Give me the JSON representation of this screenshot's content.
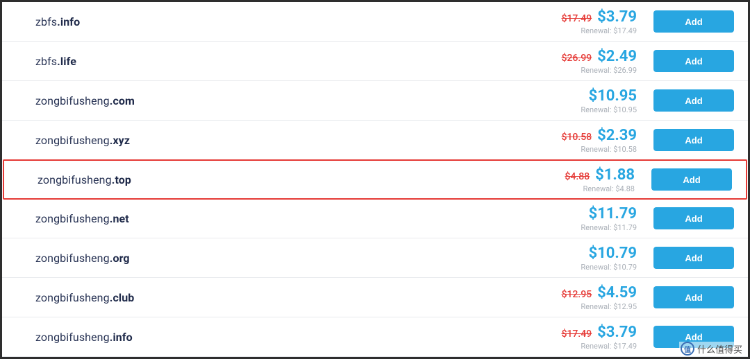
{
  "button_label": "Add",
  "renewal_prefix": "Renewal: ",
  "rows": [
    {
      "base": "zbfs",
      "tld": ".info",
      "old": "$17.49",
      "price": "$3.79",
      "renewal": "$17.49",
      "hl": false
    },
    {
      "base": "zbfs",
      "tld": ".life",
      "old": "$26.99",
      "price": "$2.49",
      "renewal": "$26.99",
      "hl": false
    },
    {
      "base": "zongbifusheng",
      "tld": ".com",
      "old": "",
      "price": "$10.95",
      "renewal": "$10.95",
      "hl": false
    },
    {
      "base": "zongbifusheng",
      "tld": ".xyz",
      "old": "$10.58",
      "price": "$2.39",
      "renewal": "$10.58",
      "hl": false
    },
    {
      "base": "zongbifusheng",
      "tld": ".top",
      "old": "$4.88",
      "price": "$1.88",
      "renewal": "$4.88",
      "hl": true
    },
    {
      "base": "zongbifusheng",
      "tld": ".net",
      "old": "",
      "price": "$11.79",
      "renewal": "$11.79",
      "hl": false
    },
    {
      "base": "zongbifusheng",
      "tld": ".org",
      "old": "",
      "price": "$10.79",
      "renewal": "$10.79",
      "hl": false
    },
    {
      "base": "zongbifusheng",
      "tld": ".club",
      "old": "$12.95",
      "price": "$4.59",
      "renewal": "$12.95",
      "hl": false
    },
    {
      "base": "zongbifusheng",
      "tld": ".info",
      "old": "$17.49",
      "price": "$3.79",
      "renewal": "$17.49",
      "hl": false
    }
  ],
  "watermark": {
    "badge": "值",
    "text": "什么值得买"
  }
}
